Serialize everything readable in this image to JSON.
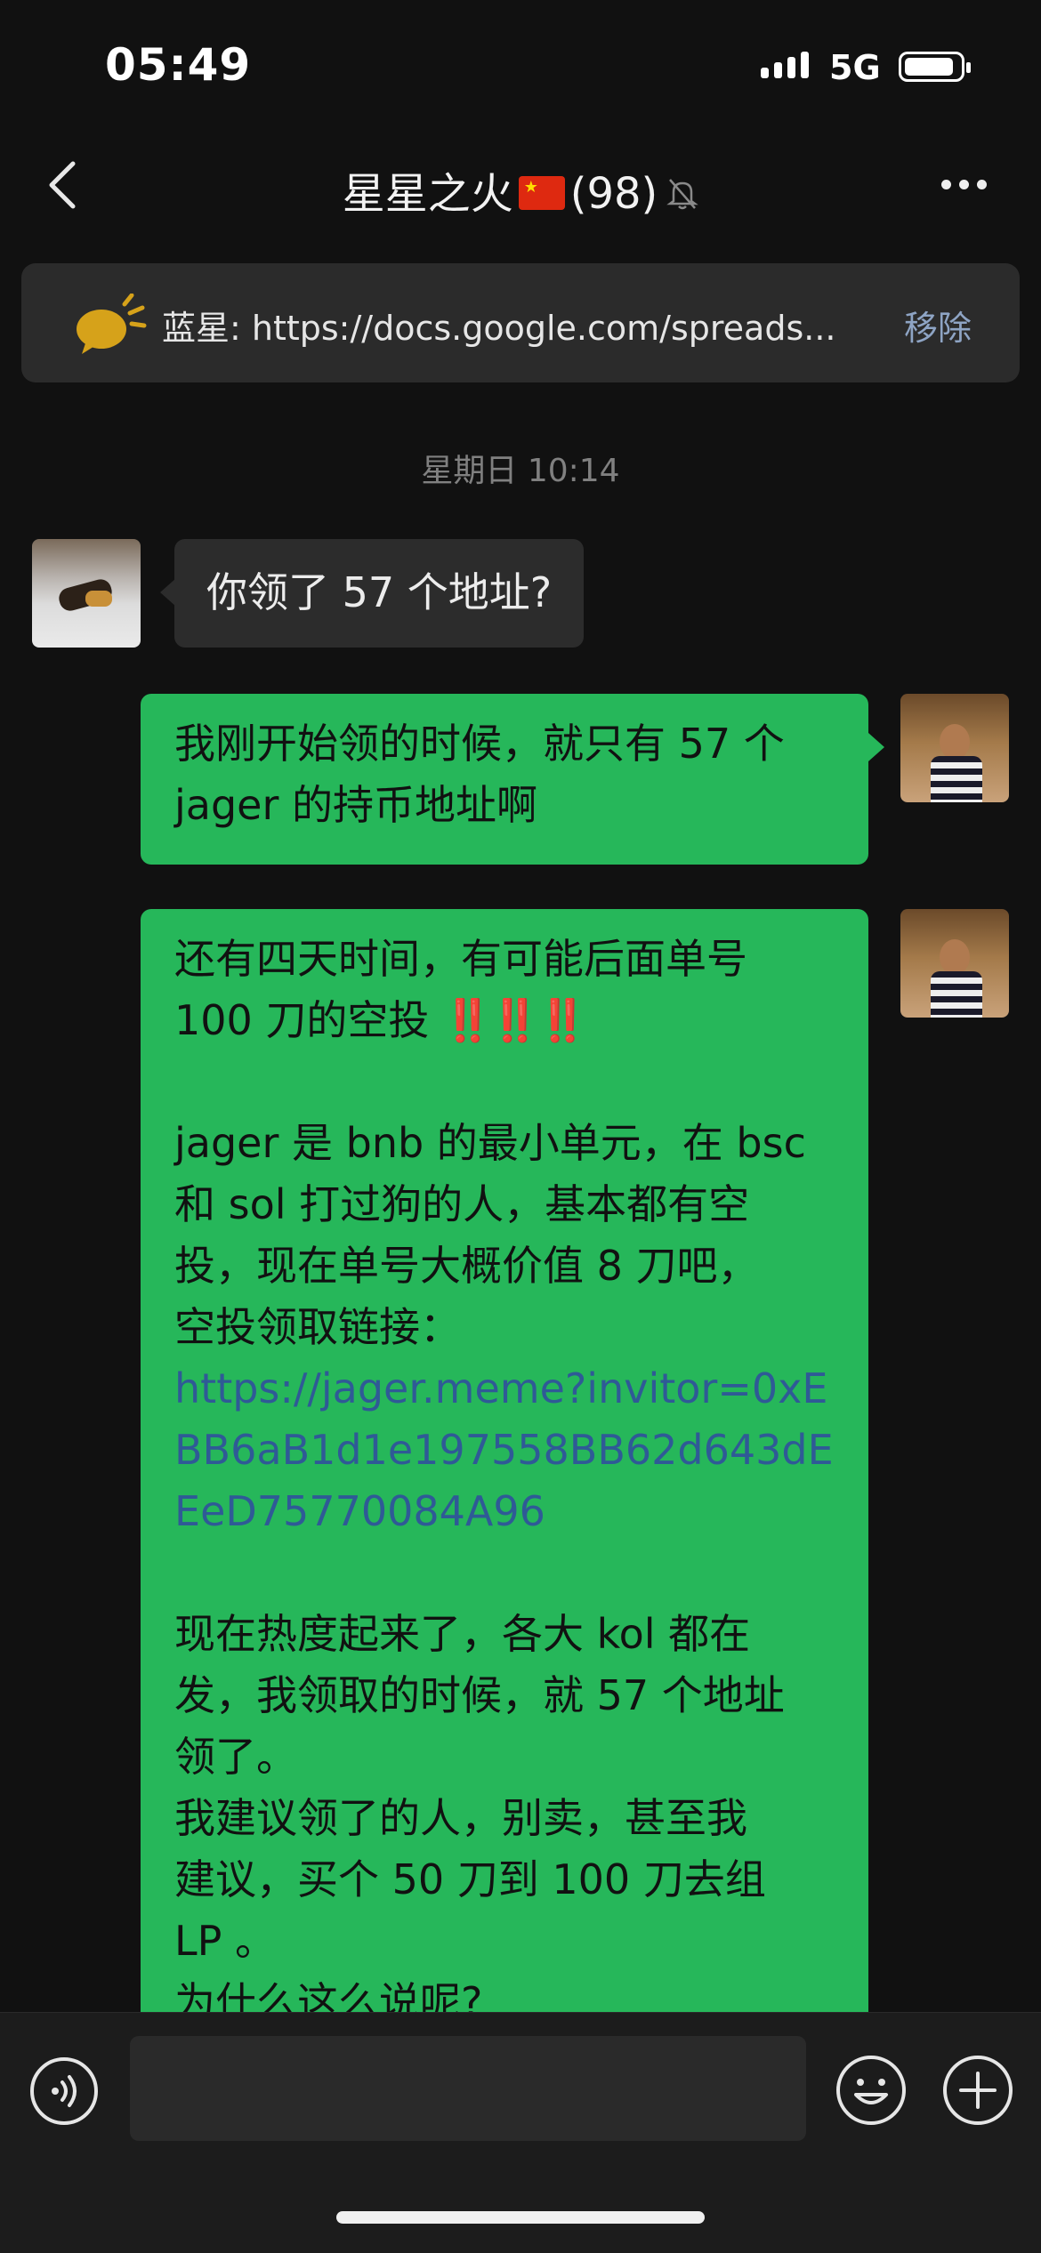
{
  "status_bar": {
    "time": "05:49",
    "network": "5G"
  },
  "header": {
    "title": "星星之火",
    "flag": "🇨🇳",
    "count": "(98)"
  },
  "pinned": {
    "text": "蓝星: https://docs.google.com/spreads...",
    "remove_label": "移除"
  },
  "timestamp": "星期日 10:14",
  "messages": {
    "in_1": "你领了 57 个地址?",
    "out_1": {
      "line1": "我刚开始领的时候，就只有 57 个",
      "line2": "jager 的持币地址啊"
    },
    "out_2": {
      "l1": "还有四天时间，有可能后面单号",
      "l2": "100 刀的空投",
      "bangs": "‼️‼️‼️",
      "l3": "jager 是 bnb 的最小单元，在 bsc",
      "l4": "和 sol 打过狗的人，基本都有空",
      "l5": "投，现在单号大概价值 8 刀吧，",
      "l6": "空投领取链接：",
      "link": "https://jager.meme?invitor=0xEBB6aB1d1e197558BB62d643dEEeD75770084A96",
      "l7": "现在热度起来了，各大 kol 都在",
      "l8": "发，我领取的时候，就 57 个地址",
      "l9": "领了。",
      "l10": "我建议领了的人，别卖，甚至我",
      "l11": "建议，买个 50 刀到 100 刀去组",
      "l12": "LP 。",
      "l13": "为什么这么说呢?"
    }
  },
  "icons": {
    "back": "chevron-left-icon",
    "mute": "bell-slash-icon",
    "more": "more-icon",
    "pin": "megaphone-icon",
    "voice": "voice-icon",
    "emoji": "emoji-icon",
    "plus": "plus-icon"
  },
  "colors": {
    "bubble_out": "#26b75a",
    "bubble_in": "#2c2c2c",
    "link": "#2f5a96",
    "background": "#111111"
  }
}
